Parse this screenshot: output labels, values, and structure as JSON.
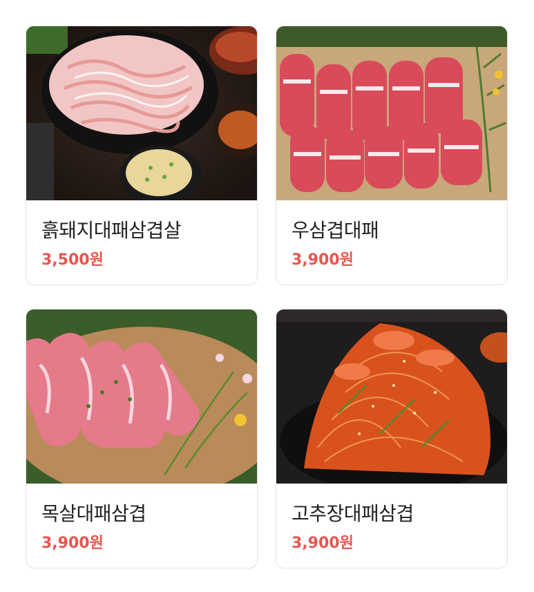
{
  "colors": {
    "price": "#e8564e",
    "name": "#222222",
    "card_border": "#e3e3e3"
  },
  "menu_items": [
    {
      "name": "흙돼지대패삼겹살",
      "price": "3,500원",
      "image": "pork-belly-platter-image"
    },
    {
      "name": "우삼겹대패",
      "price": "3,900원",
      "image": "beef-brisket-rolls-image"
    },
    {
      "name": "목살대패삼겹",
      "price": "3,900원",
      "image": "pork-neck-rolls-image"
    },
    {
      "name": "고추장대패삼겹",
      "price": "3,900원",
      "image": "spicy-pork-noodles-image"
    }
  ]
}
